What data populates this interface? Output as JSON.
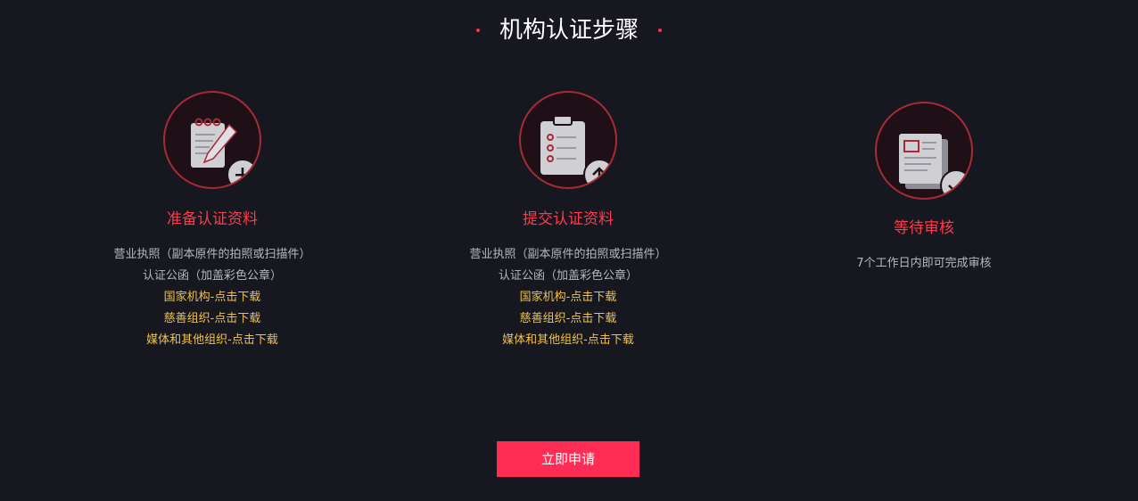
{
  "header": {
    "title": "机构认证步骤"
  },
  "steps": [
    {
      "icon": "notebook-edit-add-icon",
      "title": "准备认证资料",
      "lines": [
        "营业执照（副本原件的拍照或扫描件）",
        "认证公函（加盖彩色公章）"
      ],
      "links": [
        "国家机构-点击下载",
        "慈善组织-点击下载",
        "媒体和其他组织-点击下载"
      ]
    },
    {
      "icon": "clipboard-upload-icon",
      "title": "提交认证资料",
      "lines": [
        "营业执照（副本原件的拍照或扫描件）",
        "认证公函（加盖彩色公章）"
      ],
      "links": [
        "国家机构-点击下载",
        "慈善组织-点击下载",
        "媒体和其他组织-点击下载"
      ]
    },
    {
      "icon": "document-check-icon",
      "title": "等待审核",
      "lines": [
        "7个工作日内即可完成审核"
      ]
    }
  ],
  "actions": {
    "apply_label": "立即申请"
  },
  "colors": {
    "background": "#17181f",
    "accent": "#ff2d55",
    "step_title": "#ff3a4c",
    "link": "#f0c24a",
    "text": "#b7b7bf"
  }
}
